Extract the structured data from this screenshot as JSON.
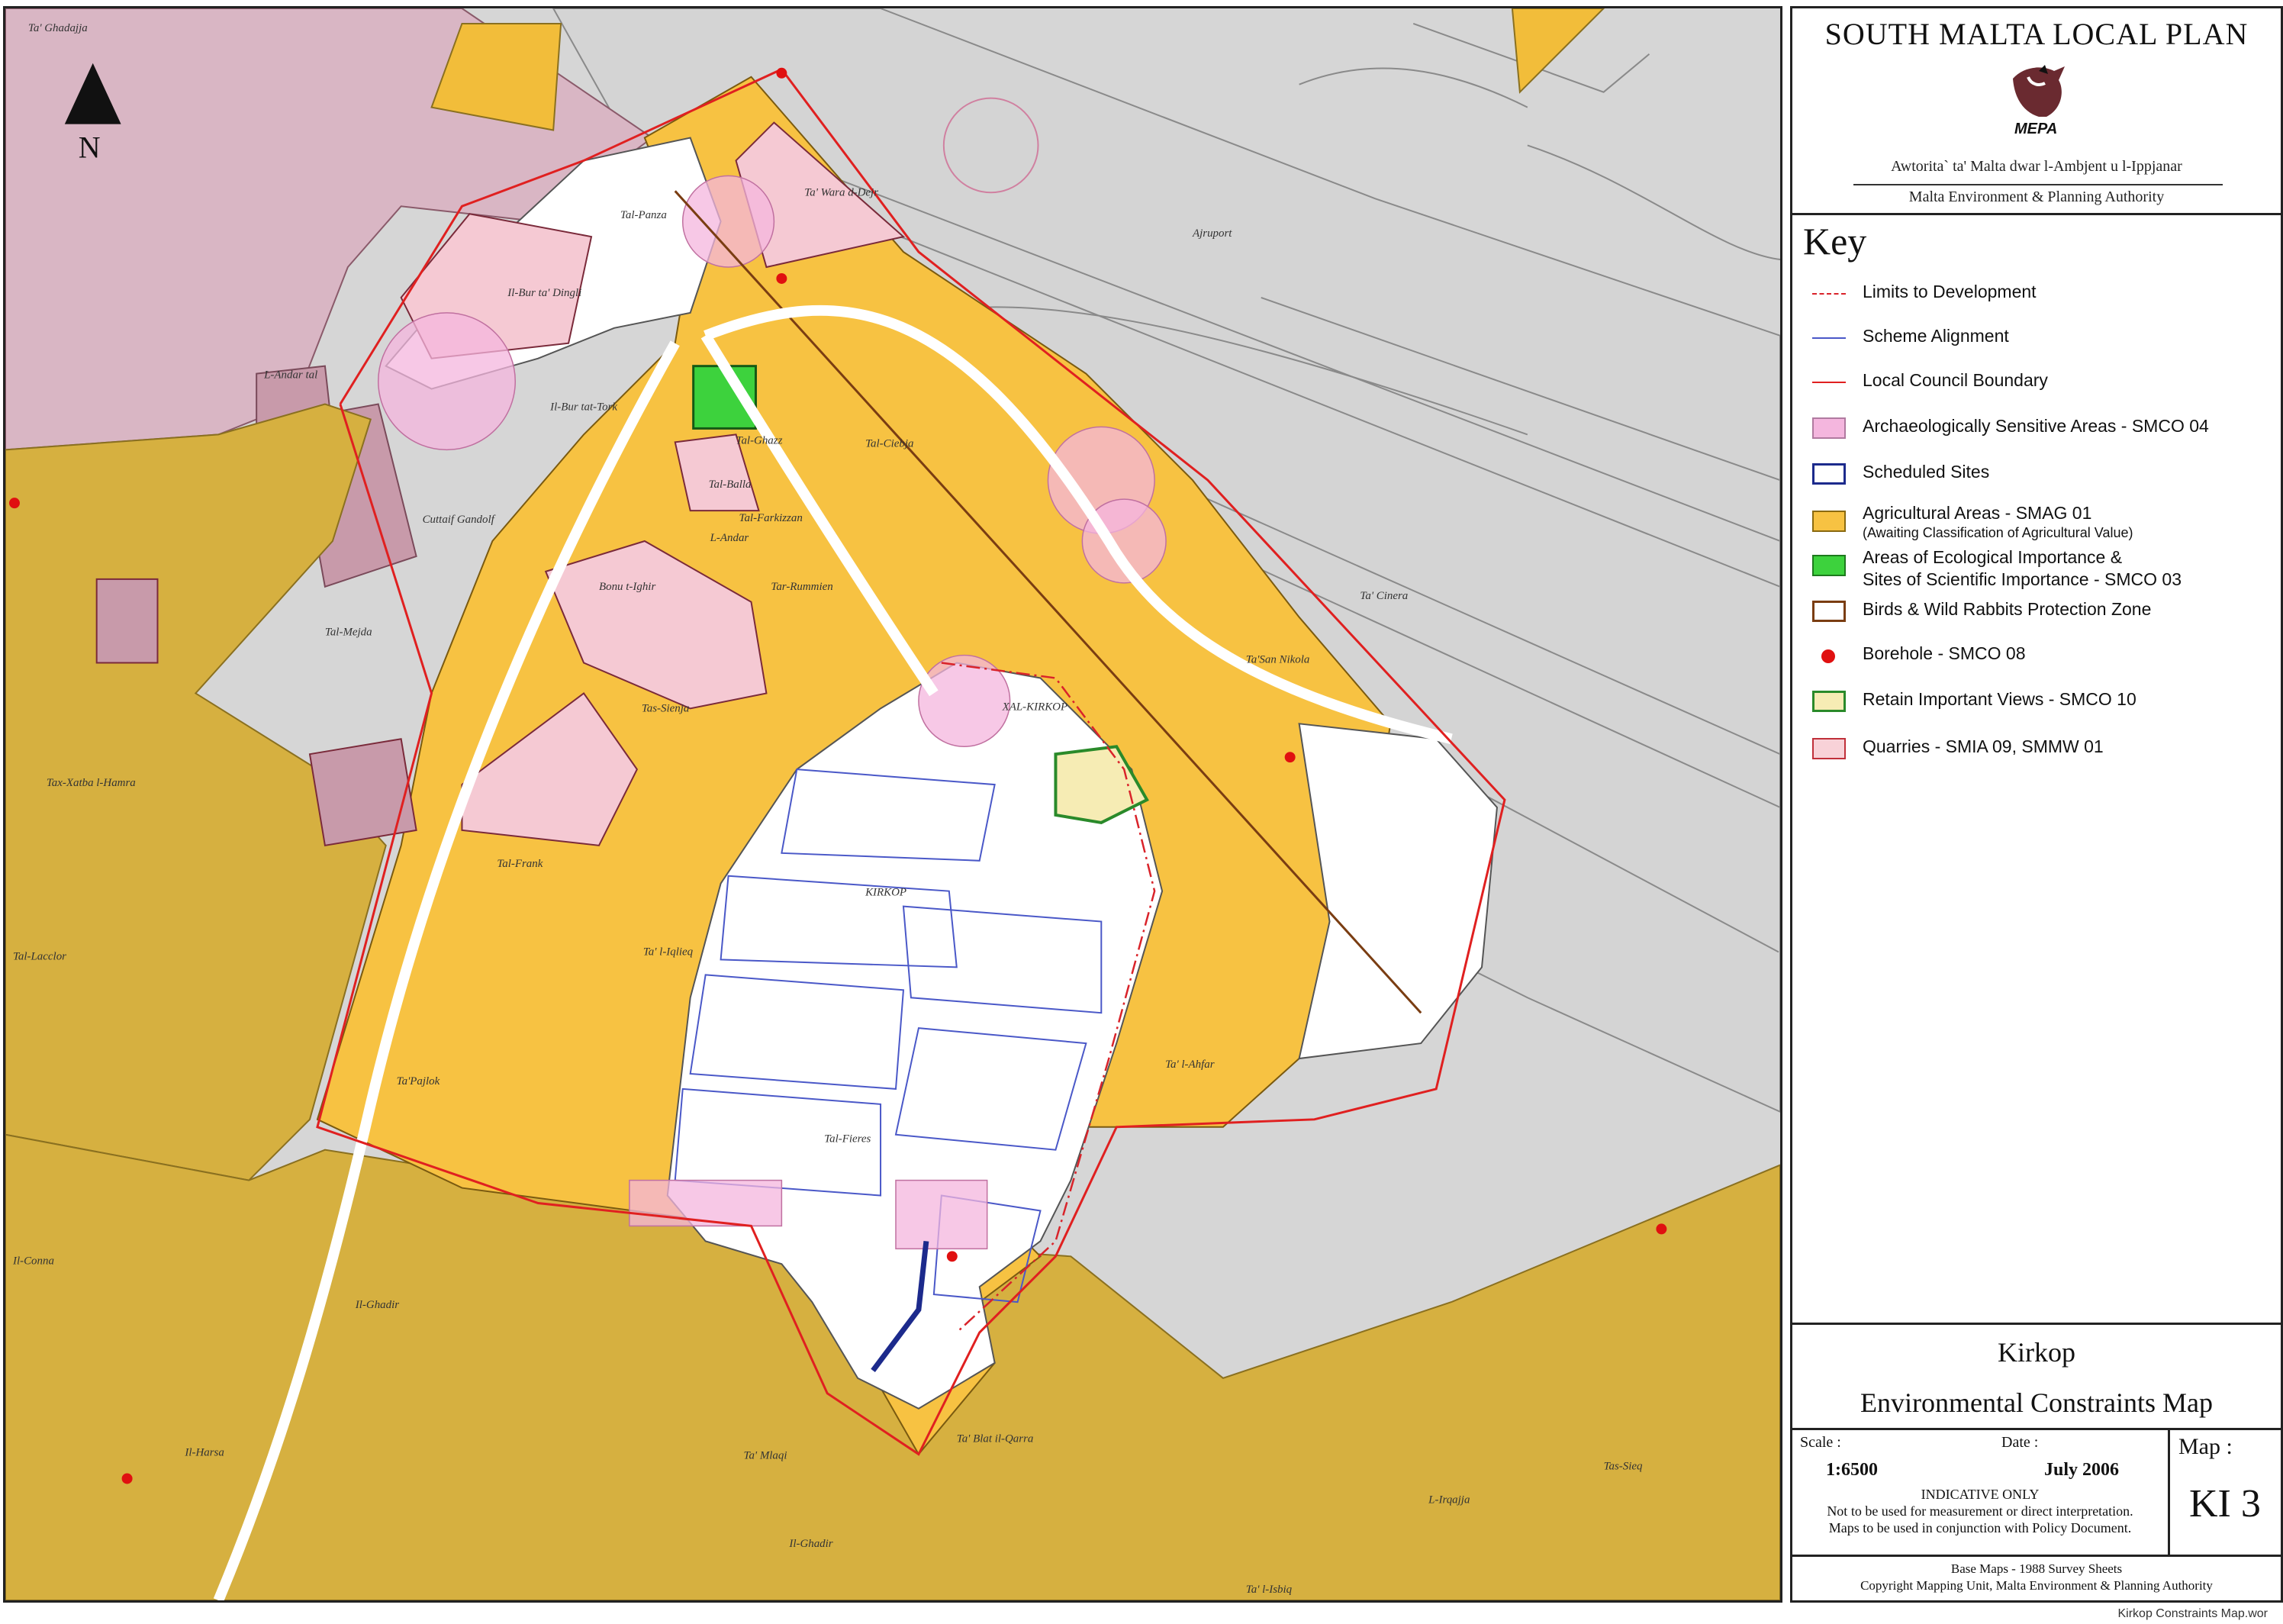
{
  "header": {
    "plan_title": "SOUTH MALTA LOCAL PLAN",
    "logo_text": "MEPA",
    "authority_mt": "Awtorita` ta' Malta dwar l-Ambjent u l-Ippjanar",
    "authority_en": "Malta Environment & Planning Authority"
  },
  "key": {
    "title": "Key",
    "items": [
      {
        "label": "Limits to Development",
        "symbol": "dash-dot-line",
        "color": "#d9232a"
      },
      {
        "label": "Scheme Alignment",
        "symbol": "line",
        "color": "#4a58c8"
      },
      {
        "label": "Local Council Boundary",
        "symbol": "line",
        "color": "#e02020"
      },
      {
        "label": "Archaeologically Sensitive Areas - SMCO 04",
        "symbol": "fill",
        "color": "#f4b6de",
        "border": "#b07aa0"
      },
      {
        "label": "Scheduled Sites",
        "symbol": "outline",
        "color": "#1c2a8c"
      },
      {
        "label": "Agricultural Areas - SMAG 01",
        "sublabel": "(Awaiting Classification of Agricultural Value)",
        "symbol": "fill",
        "color": "#f7c242",
        "border": "#8a6a10"
      },
      {
        "label": "Areas of Ecological Importance &",
        "sublabel": "Sites of Scientific Importance - SMCO 03",
        "symbol": "fill",
        "color": "#3dd23d",
        "border": "#1d7a1d"
      },
      {
        "label": "Birds & Wild Rabbits Protection Zone",
        "symbol": "outline",
        "color": "#7a3d12"
      },
      {
        "label": "Borehole - SMCO 08",
        "symbol": "dot",
        "color": "#e01010"
      },
      {
        "label": "Retain Important Views - SMCO 10",
        "symbol": "fill",
        "color": "#f6ecb4",
        "border": "#2a8a2a"
      },
      {
        "label": "Quarries - SMIA 09, SMMW 01",
        "symbol": "fill",
        "color": "#f8d2d8",
        "border": "#c0303a"
      }
    ]
  },
  "area": {
    "locality": "Kirkop",
    "map_name": "Environmental Constraints Map"
  },
  "info": {
    "scale_label": "Scale :",
    "scale_value": "1:6500",
    "date_label": "Date :",
    "date_value": "July 2006",
    "map_label": "Map :",
    "map_code": "KI 3",
    "note_heading": "INDICATIVE ONLY",
    "note_line1": "Not to be used for measurement or direct interpretation.",
    "note_line2": "Maps to be used in conjunction with Policy Document."
  },
  "footer": {
    "base_maps": "Base Maps - 1988 Survey Sheets",
    "copyright": "Copyright Mapping Unit, Malta Environment & Planning Authority",
    "file_name": "Kirkop Constraints Map.wor"
  },
  "map": {
    "north_label": "N",
    "place_labels": [
      "Ta' Ghadajja",
      "Tal-Panza",
      "Ta' Wara d-Dejr",
      "Il-Bur ta' Dingli",
      "L-Andar tal",
      "Il-Bur tat-Tork",
      "Tal-Ghazz",
      "Tal-Balla",
      "Tal-Farkizzan",
      "L-Andar",
      "Tal-Ciebja",
      "Cuttaif Gandolf",
      "Bonu t-Ighir",
      "Tal-Mejda",
      "Tar-Rummien",
      "Tas-Sienja",
      "Tax-Xatba l-Hamra",
      "XAL-KIRKOP",
      "Ta' Cinera",
      "Ajruport",
      "Ta'San Nikola",
      "Tal-Frank",
      "KIRKOP",
      "Ta' l-Iqlieq",
      "Tal-Lacclor",
      "Ta'Pajlok",
      "Tal-Fieres",
      "Ta' l-Ahfar",
      "Il-Conna",
      "Il-Ghadir",
      "Il-Harsa",
      "Ta' Mlaqi",
      "Il-Ghadir",
      "Ta' Blat il-Qarra",
      "L-Irqajja",
      "Tas-Sieq",
      "Ta' l-Isbiq"
    ]
  }
}
